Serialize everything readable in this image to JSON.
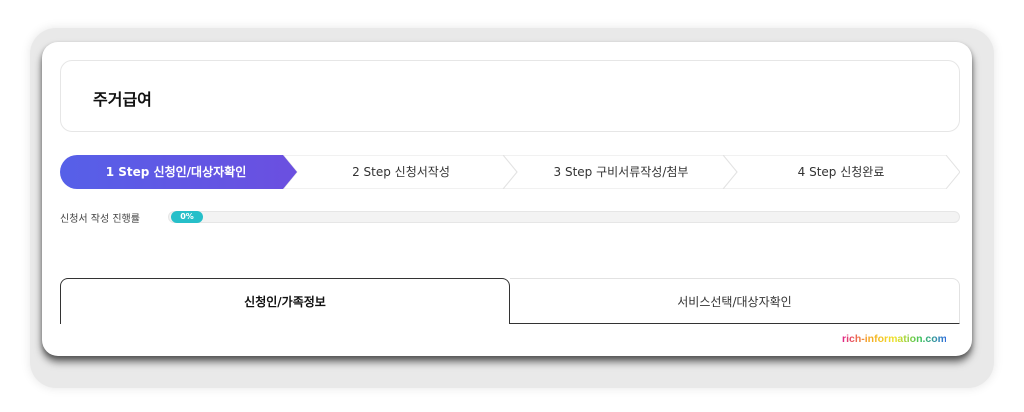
{
  "page": {
    "title": "주거급여"
  },
  "colors": {
    "active_step_start": "#5b63e6",
    "active_step_end": "#6a4fe0",
    "progress": "#26bfc9"
  },
  "stepper": {
    "steps": [
      {
        "label": "1 Step 신청인/대상자확인",
        "active": true
      },
      {
        "label": "2 Step 신청서작성",
        "active": false
      },
      {
        "label": "3 Step 구비서류작성/첨부",
        "active": false
      },
      {
        "label": "4 Step 신청완료",
        "active": false
      }
    ]
  },
  "progress": {
    "label": "신청서 작성 진행률",
    "percent_text": "0%",
    "value": 0
  },
  "tabs": [
    {
      "label": "신청인/가족정보",
      "active": true
    },
    {
      "label": "서비스선택/대상자확인",
      "active": false
    }
  ],
  "watermark": {
    "text": "rich-information.com"
  }
}
